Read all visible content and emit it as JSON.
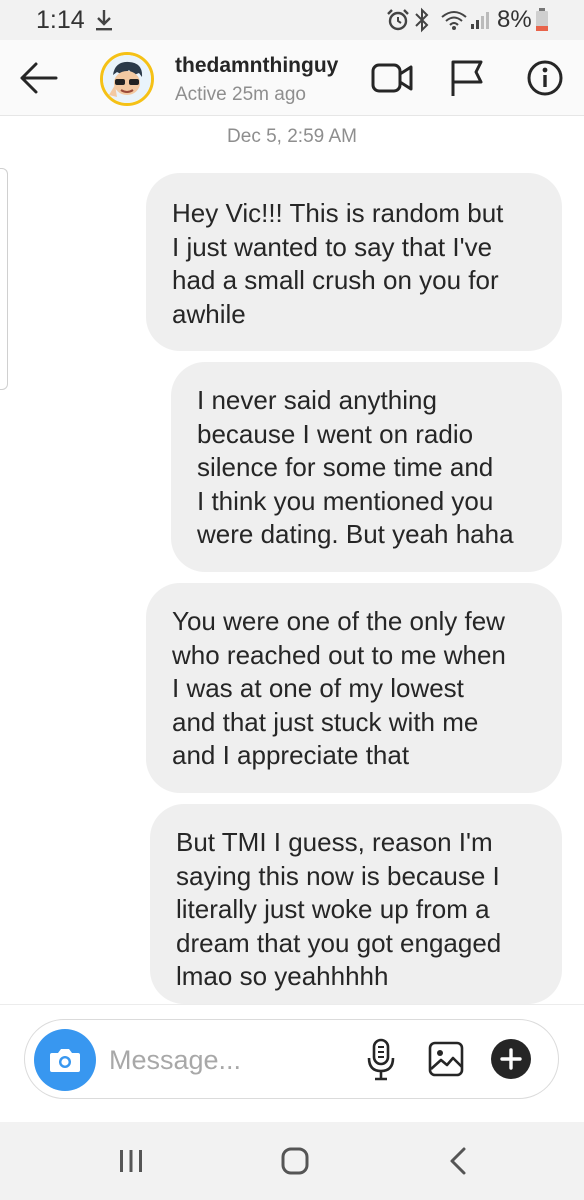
{
  "status_bar": {
    "time": "1:14",
    "battery_percent": "8%",
    "icons": [
      "download-icon",
      "alarm-icon",
      "bluetooth-icon",
      "wifi-icon",
      "signal-icon",
      "battery-icon"
    ]
  },
  "header": {
    "username": "thedamnthinguy",
    "active_status": "Active 25m ago",
    "icons": [
      "back-arrow-icon",
      "video-call-icon",
      "flag-icon",
      "info-icon"
    ]
  },
  "conversation": {
    "timestamp": "Dec 5, 2:59 AM",
    "messages": [
      {
        "text": "Hey Vic!!! This is random but\nI just wanted to say that I've\nhad a small crush on you for\nawhile"
      },
      {
        "text": "I never said anything\nbecause I went on radio\nsilence for some time and\nI think you mentioned you\nwere dating. But yeah haha"
      },
      {
        "text": "You were one of the only few\nwho reached out to me when\nI was at one of my lowest\nand that just stuck with me\nand I appreciate that"
      },
      {
        "text": "But TMI I guess, reason I'm\nsaying this now is because I\nliterally just woke up from a\ndream that you got engaged\nlmao so yeahhhhh"
      }
    ]
  },
  "composer": {
    "placeholder": "Message...",
    "value": "",
    "icons": [
      "camera-icon",
      "microphone-icon",
      "gallery-icon",
      "plus-icon"
    ]
  },
  "colors": {
    "accent": "#3897f0",
    "avatar_ring": "#f5c116",
    "bubble": "#efefef",
    "secondary_text": "#8e8e8e"
  }
}
